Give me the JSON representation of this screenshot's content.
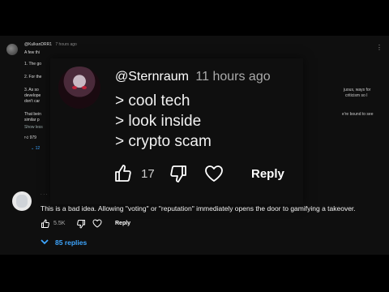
{
  "background_comment": {
    "author": "@KulkanDRR1",
    "timestamp": "7 hours ago",
    "lines": [
      "A few thi",
      "1. The go",
      "2. For the",
      "3. As so",
      "develope",
      "don't car",
      "That bein",
      "similar p"
    ],
    "show_less": "Show less",
    "right_fragments": [
      "juous, ways for",
      "criticism so I",
      "e're bound to see"
    ],
    "likes": "979",
    "replies": "12"
  },
  "card": {
    "author": "@Sternraum",
    "timestamp": "11 hours ago",
    "lines": [
      "> cool tech",
      "> look inside",
      "> crypto scam"
    ],
    "likes": "17",
    "reply_label": "Reply"
  },
  "comment2": {
    "text": "This is a bad idea. Allowing \"voting\" or \"reputation\" immediately opens the door to gamifying a takeover.",
    "likes": "5.5K",
    "reply_label": "Reply",
    "replies_label": "85 replies"
  },
  "colors": {
    "link_blue": "#3ea6ff",
    "background": "#0f0f0f"
  },
  "icons": [
    "thumb-up-icon",
    "thumb-down-icon",
    "heart-icon",
    "chevron-down-icon",
    "more-vertical-icon"
  ]
}
